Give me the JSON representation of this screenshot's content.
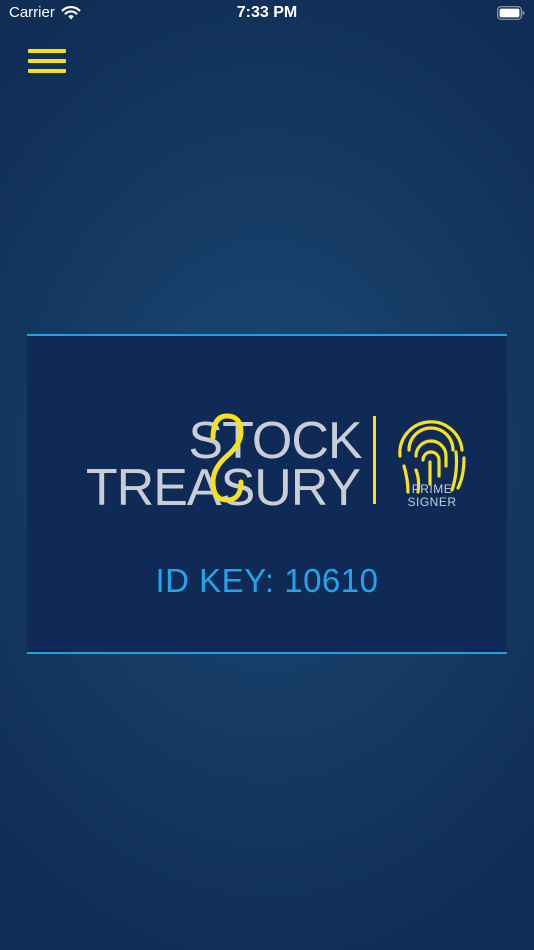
{
  "status_bar": {
    "carrier": "Carrier",
    "time": "7:33 PM",
    "icons": [
      "wifi-icon",
      "battery-icon"
    ]
  },
  "header": {
    "menu_icon": "hamburger-menu-icon"
  },
  "logo": {
    "brand_line_1": "STOCK",
    "brand_line_2": "TREASURY",
    "sub_brand_line_1": "PRIME",
    "sub_brand_line_2": "SIGNER",
    "fingerprint_icon": "fingerprint-icon"
  },
  "id_key": {
    "text": "ID KEY: 10610"
  },
  "colors": {
    "background": "#163c66",
    "card": "#0f2a57",
    "accent_blue": "#1aa4e6",
    "accent_yellow": "#f7e11b",
    "logo_text": "#c8cdd6"
  }
}
